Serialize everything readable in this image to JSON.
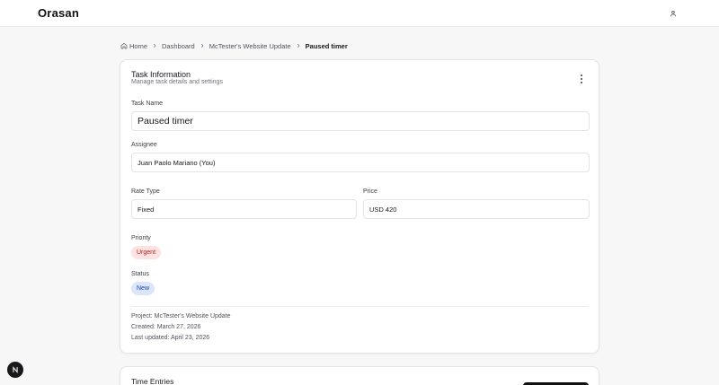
{
  "app": {
    "name": "Orasan"
  },
  "breadcrumb": {
    "home": "Home",
    "dashboard": "Dashboard",
    "project": "McTester's Website Update",
    "current": "Paused timer"
  },
  "task_info": {
    "title": "Task Information",
    "subtitle": "Manage task details and settings",
    "task_name_label": "Task Name",
    "task_name_value": "Paused timer",
    "assignee_label": "Assignee",
    "assignee_value": "Juan Paolo Mariano (You)",
    "rate_type_label": "Rate Type",
    "rate_type_value": "Fixed",
    "price_label": "Price",
    "price_value": "USD 420",
    "priority_label": "Priority",
    "priority_value": "Urgent",
    "status_label": "Status",
    "status_value": "New",
    "meta_project": "Project: McTester's Website Update",
    "meta_created": "Created: March 27, 2026",
    "meta_updated": "Last updated: April 23, 2026"
  },
  "time_entries": {
    "title": "Time Entries"
  },
  "icons": {
    "user": "user-icon",
    "home": "home-icon",
    "chevron": "chevron-right-icon",
    "more": "more-vertical-icon",
    "dev": "next-logo-icon"
  },
  "colors": {
    "urgent_bg": "#fde2e2",
    "urgent_text": "#b91c1c",
    "new_bg": "#dbe6fb",
    "new_text": "#1e40af"
  }
}
